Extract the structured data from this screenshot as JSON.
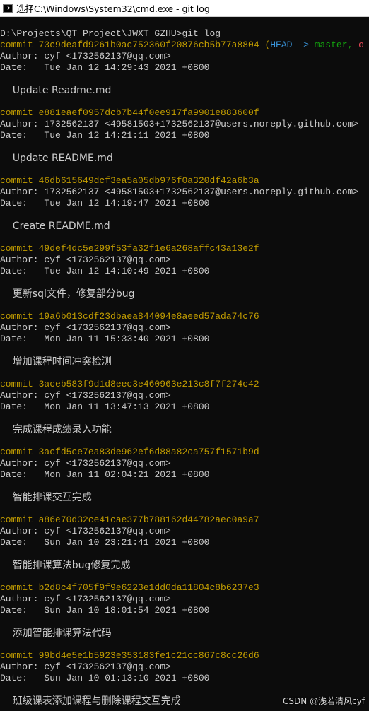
{
  "window": {
    "title": "选择C:\\Windows\\System32\\cmd.exe - git  log"
  },
  "console": {
    "prompt": "D:\\Projects\\QT Project\\JWXT_GZHU>git log",
    "first_commit": {
      "prefix": "commit 73c9deafd9261b0ac752360f20876cb5b77a8804 ",
      "paren_open": "(",
      "head": "HEAD -> ",
      "branch": "master, ",
      "trailing": "o"
    },
    "labels": {
      "author": "Author: ",
      "date": "Date:   "
    },
    "commits": [
      {
        "hash": "",
        "author": "cyf <1732562137@qq.com>",
        "date": "Tue Jan 12 14:29:43 2021 +0800",
        "message": "    Update Readme.md"
      },
      {
        "hash": "commit e881eaef0957dcb7b44f0ee917fa9901e883600f",
        "author": "1732562137 <49581503+1732562137@users.noreply.github.com>",
        "date": "Tue Jan 12 14:21:11 2021 +0800",
        "message": "    Update README.md"
      },
      {
        "hash": "commit 46db615649dcf3ea5a05db976f0a320df42a6b3a",
        "author": "1732562137 <49581503+1732562137@users.noreply.github.com>",
        "date": "Tue Jan 12 14:19:47 2021 +0800",
        "message": "    Create README.md"
      },
      {
        "hash": "commit 49def4dc5e299f53fa32f1e6a268affc43a13e2f",
        "author": "cyf <1732562137@qq.com>",
        "date": "Tue Jan 12 14:10:49 2021 +0800",
        "message": "    更新sql文件，修复部分bug"
      },
      {
        "hash": "commit 19a6b013cdf23dbaea844094e8aeed57ada74c76",
        "author": "cyf <1732562137@qq.com>",
        "date": "Mon Jan 11 15:33:40 2021 +0800",
        "message": "    增加课程时间冲突检测"
      },
      {
        "hash": "commit 3aceb583f9d1d8eec3e460963e213c8f7f274c42",
        "author": "cyf <1732562137@qq.com>",
        "date": "Mon Jan 11 13:47:13 2021 +0800",
        "message": "    完成课程成绩录入功能"
      },
      {
        "hash": "commit 3acfd5ce7ea83de962ef6d88a82ca757f1571b9d",
        "author": "cyf <1732562137@qq.com>",
        "date": "Mon Jan 11 02:04:21 2021 +0800",
        "message": "    智能排课交互完成"
      },
      {
        "hash": "commit a86e70d32ce41cae377b788162d44782aec0a9a7",
        "author": "cyf <1732562137@qq.com>",
        "date": "Sun Jan 10 23:21:41 2021 +0800",
        "message": "    智能排课算法bug修复完成"
      },
      {
        "hash": "commit b2d8c4f705f9f9e6223e1dd0da11804c8b6237e3",
        "author": "cyf <1732562137@qq.com>",
        "date": "Sun Jan 10 18:01:54 2021 +0800",
        "message": "    添加智能排课算法代码"
      },
      {
        "hash": "commit 99bd4e5e1b5923e353183fe1c21cc867c8cc26d6",
        "author": "cyf <1732562137@qq.com>",
        "date": "Sun Jan 10 01:13:10 2021 +0800",
        "message": "    班级课表添加课程与删除课程交互完成"
      }
    ]
  },
  "watermark": "CSDN @浅若清风cyf",
  "colors": {
    "background": "#0c0c0c",
    "foreground": "#cccccc",
    "commit_hash": "#c19c00",
    "head": "#3a96dd",
    "branch": "#13a10e",
    "origin": "#e74856",
    "titlebar": "#ffffff"
  }
}
